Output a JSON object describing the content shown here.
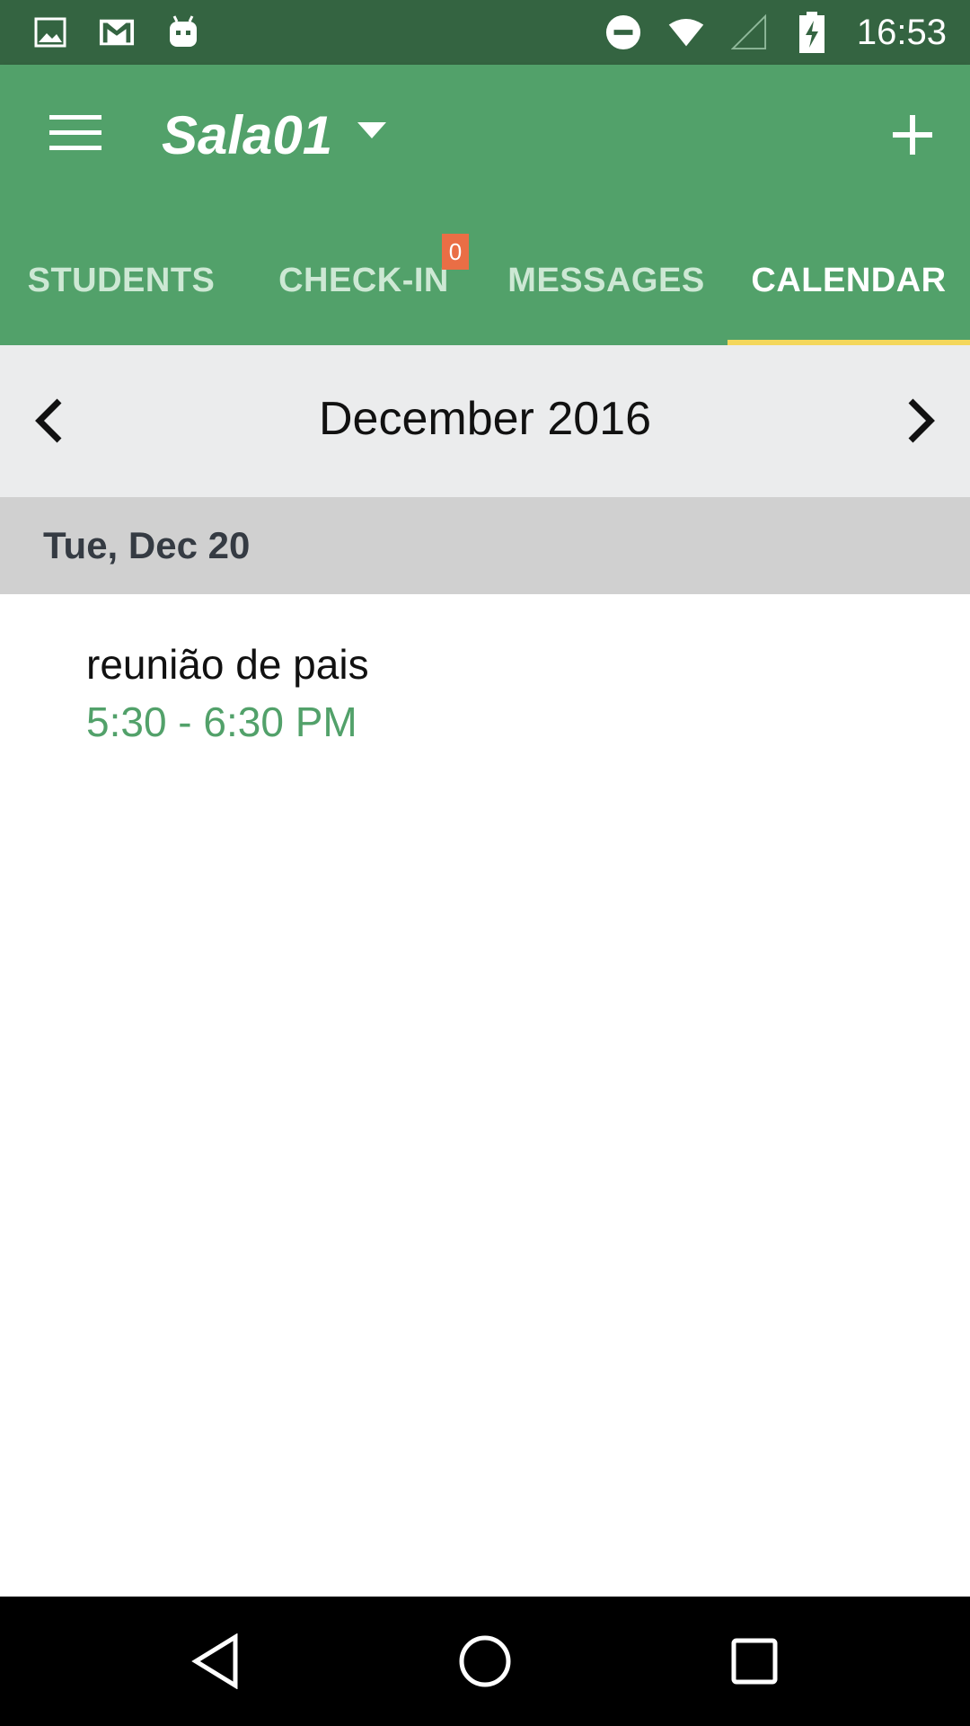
{
  "status_bar": {
    "time": "16:53",
    "left_icons": [
      "image-icon",
      "gmail-icon",
      "android-icon"
    ],
    "right_icons": [
      "do-not-disturb-icon",
      "wifi-icon",
      "signal-icon",
      "battery-charging-icon"
    ]
  },
  "app_bar": {
    "title": "Sala01",
    "colors": {
      "primary": "#52a16a",
      "status": "#346441",
      "indicator": "#f4d75c",
      "badge": "#ea6e45"
    }
  },
  "tabs": [
    {
      "label": "STUDENTS",
      "active": false
    },
    {
      "label": "CHECK-IN",
      "active": false,
      "badge": "0"
    },
    {
      "label": "MESSAGES",
      "active": false
    },
    {
      "label": "CALENDAR",
      "active": true
    }
  ],
  "calendar": {
    "month_label": "December 2016",
    "date_label": "Tue, Dec 20",
    "events": [
      {
        "title": "reunião de pais",
        "time": "5:30 - 6:30 PM"
      }
    ]
  },
  "nav_bar": {
    "buttons": [
      "back-icon",
      "home-icon",
      "recents-icon"
    ]
  }
}
